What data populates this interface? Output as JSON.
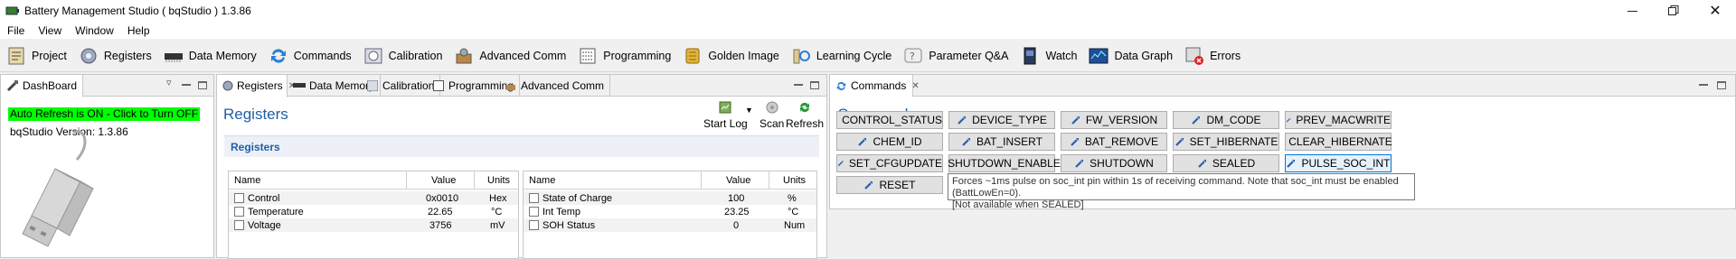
{
  "window": {
    "title": "Battery Management Studio ( bqStudio ) 1.3.86"
  },
  "menu": [
    "File",
    "View",
    "Window",
    "Help"
  ],
  "toolbar": [
    {
      "label": "Project",
      "icon": "project-icon"
    },
    {
      "label": "Registers",
      "icon": "registers-icon"
    },
    {
      "label": "Data Memory",
      "icon": "data-memory-icon"
    },
    {
      "label": "Commands",
      "icon": "commands-icon"
    },
    {
      "label": "Calibration",
      "icon": "calibration-icon"
    },
    {
      "label": "Advanced Comm",
      "icon": "advanced-comm-icon"
    },
    {
      "label": "Programming",
      "icon": "programming-icon"
    },
    {
      "label": "Golden Image",
      "icon": "golden-image-icon"
    },
    {
      "label": "Learning Cycle",
      "icon": "learning-cycle-icon"
    },
    {
      "label": "Parameter Q&A",
      "icon": "parameter-qa-icon"
    },
    {
      "label": "Watch",
      "icon": "watch-icon"
    },
    {
      "label": "Data Graph",
      "icon": "data-graph-icon"
    },
    {
      "label": "Errors",
      "icon": "errors-icon"
    }
  ],
  "dashboard": {
    "tab_label": "DashBoard",
    "auto_refresh": "Auto Refresh is ON - Click to Turn OFF",
    "version": "bqStudio Version:  1.3.86"
  },
  "registers_panel": {
    "tabs": [
      "Registers",
      "Data Memory",
      "Calibration",
      "Programming",
      "Advanced Comm"
    ],
    "title": "Registers",
    "section": "Registers",
    "start_log": "Start Log",
    "scan": "Scan",
    "refresh": "Refresh",
    "left_table": {
      "headers": [
        "Name",
        "Value",
        "Units"
      ],
      "rows": [
        {
          "name": "Control",
          "value": "0x0010",
          "units": "Hex"
        },
        {
          "name": "Temperature",
          "value": "22.65",
          "units": "°C"
        },
        {
          "name": "Voltage",
          "value": "3756",
          "units": "mV"
        }
      ]
    },
    "right_table": {
      "headers": [
        "Name",
        "Value",
        "Units"
      ],
      "rows": [
        {
          "name": "State of Charge",
          "value": "100",
          "units": "%"
        },
        {
          "name": "Int Temp",
          "value": "23.25",
          "units": "°C"
        },
        {
          "name": "SOH Status",
          "value": "0",
          "units": "Num"
        }
      ]
    }
  },
  "commands_panel": {
    "tab_label": "Commands",
    "title": "Commands",
    "buttons": [
      "CONTROL_STATUS",
      "DEVICE_TYPE",
      "FW_VERSION",
      "DM_CODE",
      "PREV_MACWRITE",
      "CHEM_ID",
      "BAT_INSERT",
      "BAT_REMOVE",
      "SET_HIBERNATE",
      "CLEAR_HIBERNATE",
      "SET_CFGUPDATE",
      "SHUTDOWN_ENABLE",
      "SHUTDOWN",
      "SEALED",
      "PULSE_SOC_INT",
      "RESET"
    ],
    "tooltip_line1": "Forces ~1ms pulse on soc_int pin within 1s of receiving command.  Note that soc_int must be enabled (BattLowEn=0).",
    "tooltip_line2": "[Not available when SEALED]"
  },
  "colors": {
    "accent_blue": "#1f5fa8",
    "auto_refresh_bg": "#00ff00"
  }
}
